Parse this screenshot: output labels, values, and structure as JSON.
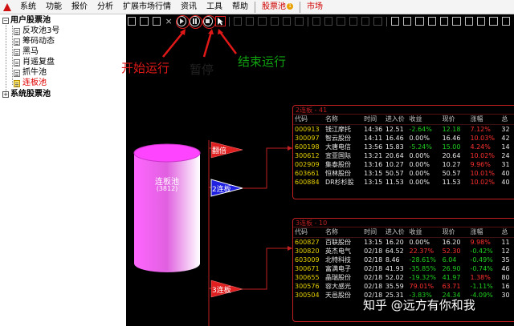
{
  "menu": {
    "items": [
      "系统",
      "功能",
      "报价",
      "分析",
      "扩展市场行情",
      "资讯",
      "工具",
      "帮助"
    ],
    "stock_pool": "股票池",
    "stock_pool_badge": "1",
    "market": "市场"
  },
  "tree": {
    "user_pool": "用户股票池",
    "user_items": [
      "反攻池3号",
      "筹码动态",
      "黑马",
      "肖遥复盘",
      "抓牛池",
      "连板池"
    ],
    "system_pool": "系统股票池"
  },
  "annotations": {
    "start": "开始运行",
    "pause": "暂停",
    "stop": "结束运行"
  },
  "canvas": {
    "cylinder_label": "连板池",
    "cylinder_count": "(3812)",
    "node_fanbao": "翻倍",
    "node_2lianban": "2连板",
    "node_3lianban": "3连板"
  },
  "colors": {
    "pool_magenta": "#e060e0",
    "panel_border": "#c02020",
    "code_yellow": "#e6d000",
    "up_red": "#ff3030",
    "down_green": "#20d020",
    "highlight_red": "#e02020"
  },
  "panel1": {
    "title": "2连板 - 41",
    "columns": [
      "代码",
      "名称",
      "时间",
      "进入价",
      "收益",
      "现价",
      "涨幅",
      "总"
    ],
    "rows": [
      [
        "000913",
        "钱江摩托",
        "14:36",
        "12.51",
        "-2.64%",
        "12.18",
        "7.12%",
        "32"
      ],
      [
        "300097",
        "智云股份",
        "14:11",
        "16.46",
        "0.00%",
        "16.46",
        "10.03%",
        "42"
      ],
      [
        "600198",
        "大唐电信",
        "13:56",
        "15.83",
        "-5.24%",
        "15.00",
        "4.24%",
        "14"
      ],
      [
        "300612",
        "宣亚国际",
        "13:21",
        "20.64",
        "0.00%",
        "20.64",
        "10.02%",
        "24"
      ],
      [
        "002909",
        "集泰股份",
        "13:16",
        "10.27",
        "0.00%",
        "10.27",
        "9.96%",
        "31"
      ],
      [
        "603661",
        "恒林股份",
        "13:15",
        "50.57",
        "0.00%",
        "50.57",
        "10.01%",
        "40"
      ],
      [
        "600884",
        "DR杉杉股",
        "13:15",
        "11.53",
        "0.00%",
        "11.53",
        "10.02%",
        "40"
      ]
    ]
  },
  "panel2": {
    "title": "3连板 - 10",
    "columns": [
      "代码",
      "名称",
      "时间",
      "进入价",
      "收益",
      "现价",
      "涨幅",
      "总"
    ],
    "rows": [
      [
        "600827",
        "百联股份",
        "13:15",
        "16.20",
        "0.00%",
        "16.20",
        "9.98%",
        "11"
      ],
      [
        "300820",
        "英杰电气",
        "02/18",
        "64.52",
        "22.37%",
        "52.30",
        "-0.42%",
        "12"
      ],
      [
        "603009",
        "北特科技",
        "02/18",
        "8.46",
        "-28.61%",
        "6.04",
        "-0.49%",
        "35"
      ],
      [
        "300671",
        "富满电子",
        "02/18",
        "41.93",
        "-35.85%",
        "26.90",
        "-0.74%",
        "46"
      ],
      [
        "300655",
        "晶瑞股份",
        "02/18",
        "52.02",
        "-19.32%",
        "41.97",
        "1.38%",
        "80"
      ],
      [
        "300576",
        "容大感光",
        "02/18",
        "35.59",
        "79.01%",
        "63.71",
        "-1.11%",
        "16"
      ],
      [
        "300504",
        "天邑股份",
        "02/18",
        "25.31",
        "-3.83%",
        "24.34",
        "-4.09%",
        "30"
      ]
    ]
  },
  "watermark": "知乎 @远方有你和我"
}
